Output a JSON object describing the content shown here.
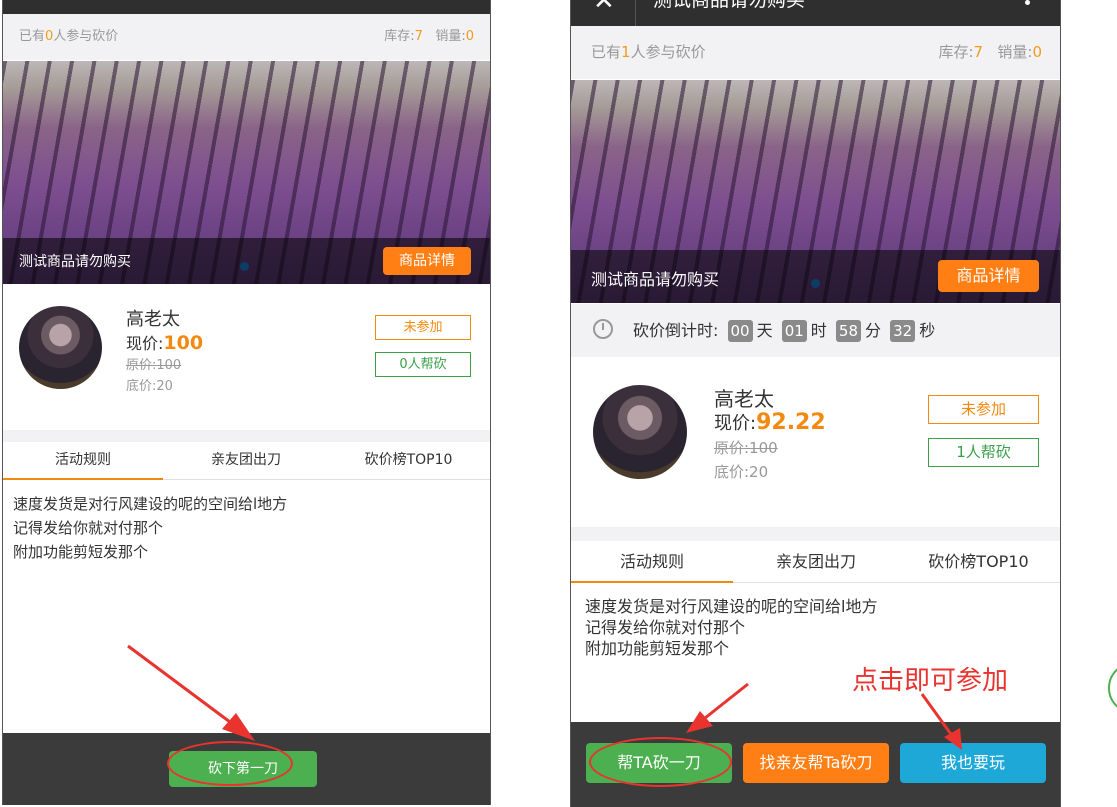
{
  "left": {
    "stats": {
      "participants_prefix": "已有",
      "participants_count": "0",
      "participants_suffix": "人参与砍价",
      "stock_label": "库存:",
      "stock_value": "7",
      "sales_label": "销量:",
      "sales_value": "0"
    },
    "banner": {
      "product_name": "测试商品请勿购买",
      "detail_button": "商品详情"
    },
    "user": {
      "name": "高老太",
      "price_label": "现价:",
      "price_value": "100",
      "original_price": "原价:100",
      "floor_price": "底价:20"
    },
    "status_button": "未参加",
    "helpers_button": "0人帮砍",
    "tabs": [
      "活动规则",
      "亲友团出刀",
      "砍价榜TOP10"
    ],
    "rules": [
      "速度发货是对行风建设的呢的空间给l地方",
      "记得发给你就对付那个",
      "附加功能剪短发那个"
    ],
    "footer_button": "砍下第一刀"
  },
  "right": {
    "header_title": "测试商品请勿购买",
    "stats": {
      "participants_prefix": "已有",
      "participants_count": "1",
      "participants_suffix": "人参与砍价",
      "stock_label": "库存:",
      "stock_value": "7",
      "sales_label": "销量:",
      "sales_value": "0"
    },
    "banner": {
      "product_name": "测试商品请勿购买",
      "detail_button": "商品详情"
    },
    "countdown": {
      "label": "砍价倒计时:",
      "days": "00",
      "days_unit": "天",
      "hours": "01",
      "hours_unit": "时",
      "minutes": "58",
      "minutes_unit": "分",
      "seconds": "32",
      "seconds_unit": "秒"
    },
    "user": {
      "name": "高老太",
      "price_label": "现价:",
      "price_value": "92.22",
      "original_price": "原价:100",
      "floor_price": "底价:20"
    },
    "status_button": "未参加",
    "helpers_button": "1人帮砍",
    "tabs": [
      "活动规则",
      "亲友团出刀",
      "砍价榜TOP10"
    ],
    "rules": [
      "速度发货是对行风建设的呢的空间给l地方",
      "记得发给你就对付那个",
      "附加功能剪短发那个"
    ],
    "footer_buttons": {
      "help": "帮TA砍一刀",
      "friends": "找亲友帮Ta砍刀",
      "join": "我也要玩"
    }
  },
  "annotation": {
    "text": "点击即可参加"
  },
  "colors": {
    "accent_orange": "#ff7f14",
    "price_orange": "#f38a10",
    "green": "#4caf50",
    "blue": "#1ea8d8",
    "annotation_red": "#e8332e",
    "footer_dark": "#3b3b3b"
  }
}
